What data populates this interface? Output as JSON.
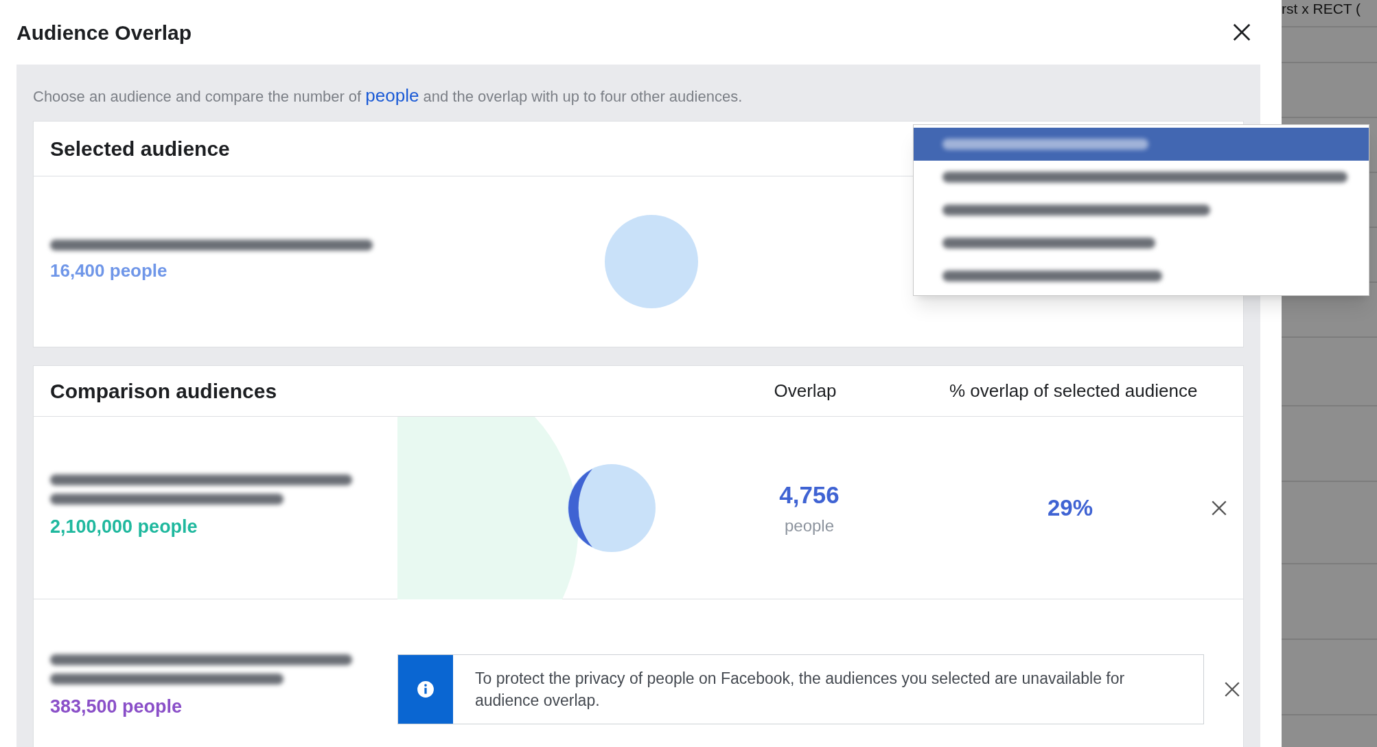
{
  "background": {
    "text": "rst x RECT ("
  },
  "dialog": {
    "title": "Audience Overlap",
    "description_parts": [
      "Choose an audience and compare the number of ",
      "people",
      " and the overlap with up to four other audiences."
    ]
  },
  "selected_audience": {
    "heading": "Selected audience",
    "size": "16,400 people",
    "color": "#6f96e8"
  },
  "dropdown": {
    "items": [
      {
        "selected": true
      },
      {
        "selected": false
      },
      {
        "selected": false
      },
      {
        "selected": false
      },
      {
        "selected": false
      }
    ]
  },
  "comparison": {
    "heading": "Comparison audiences",
    "columns": [
      "Overlap",
      "% overlap of selected audience"
    ],
    "rows": [
      {
        "kind": "overlap",
        "size": "2,100,000 people",
        "color": "#1fb89e",
        "overlap": "4,756",
        "overlap_unit": "people",
        "percent": "29%"
      },
      {
        "kind": "notice",
        "size": "383,500 people",
        "color": "#8a4fc8",
        "notice": "To protect the privacy of people on Facebook, the audiences you selected are unavailable for audience overlap."
      }
    ]
  }
}
